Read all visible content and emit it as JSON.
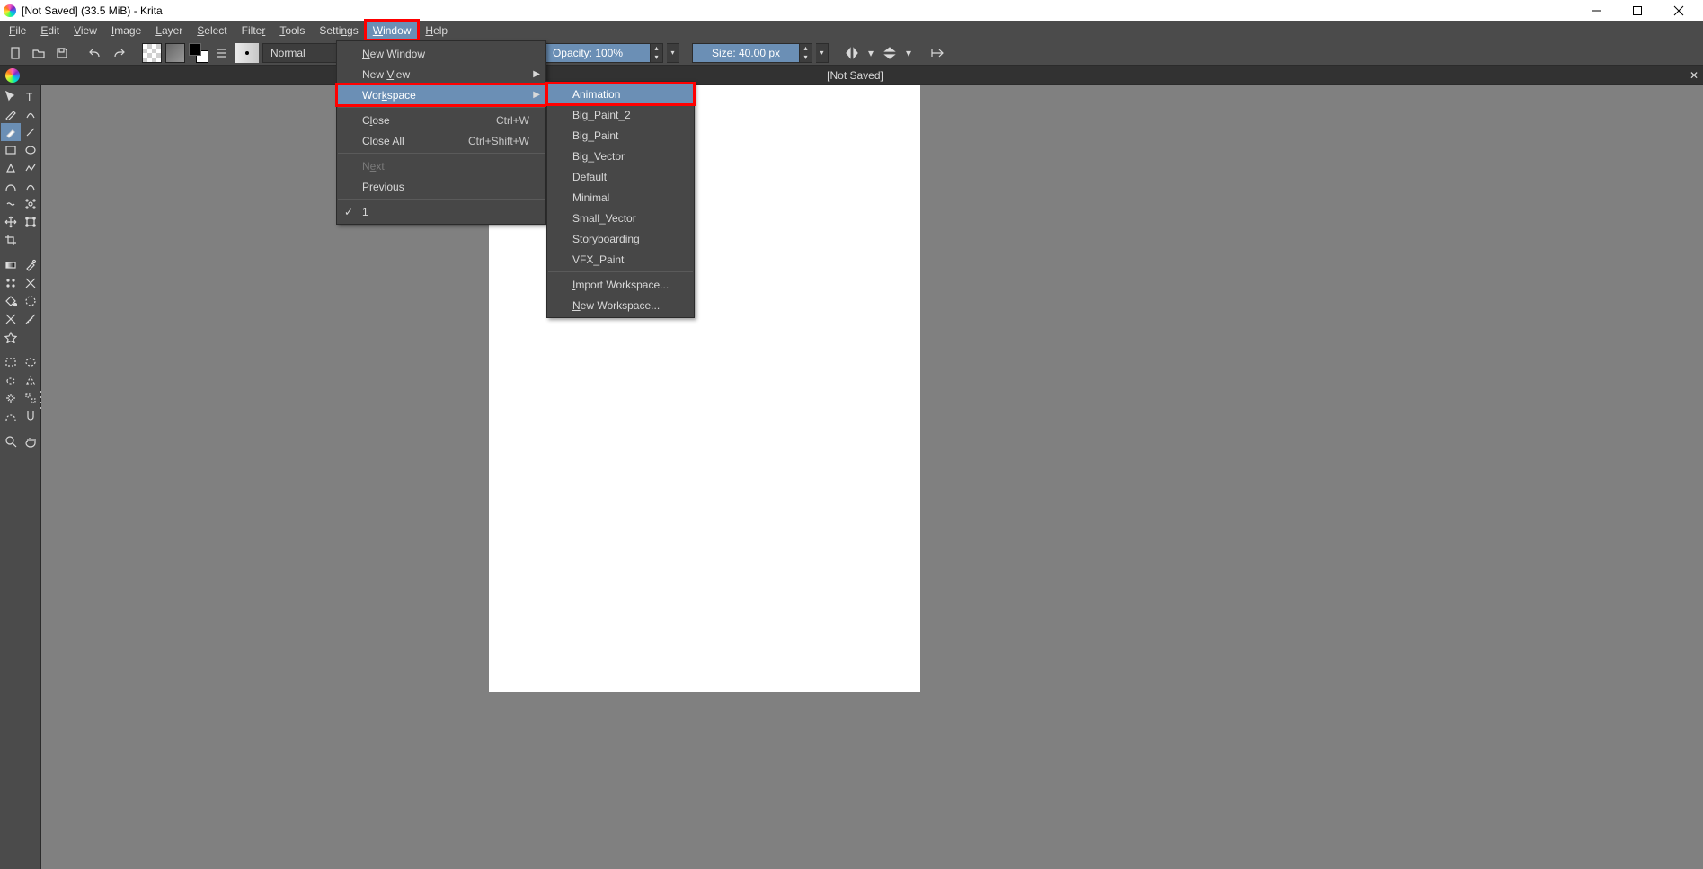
{
  "title": "[Not Saved]  (33.5 MiB)  - Krita",
  "menus": {
    "file": "File",
    "edit": "Edit",
    "view": "View",
    "image": "Image",
    "layer": "Layer",
    "select": "Select",
    "filter": "Filter",
    "tools": "Tools",
    "settings": "Settings",
    "window": "Window",
    "help": "Help"
  },
  "toolbar": {
    "blend_mode": "Normal",
    "opacity": "Opacity: 100%",
    "size": "Size: 40.00 px"
  },
  "document_tab": "[Not Saved]",
  "window_menu": {
    "new_window": "New Window",
    "new_view": "New View",
    "workspace": "Workspace",
    "close": "Close",
    "close_shortcut": "Ctrl+W",
    "close_all": "Close All",
    "close_all_shortcut": "Ctrl+Shift+W",
    "next": "Next",
    "previous": "Previous",
    "doc1": "1"
  },
  "workspace_submenu": {
    "animation": "Animation",
    "big_paint_2": "Big_Paint_2",
    "big_paint": "Big_Paint",
    "big_vector": "Big_Vector",
    "default": "Default",
    "minimal": "Minimal",
    "small_vector": "Small_Vector",
    "storyboarding": "Storyboarding",
    "vfx_paint": "VFX_Paint",
    "import": "Import Workspace...",
    "new": "New Workspace..."
  }
}
